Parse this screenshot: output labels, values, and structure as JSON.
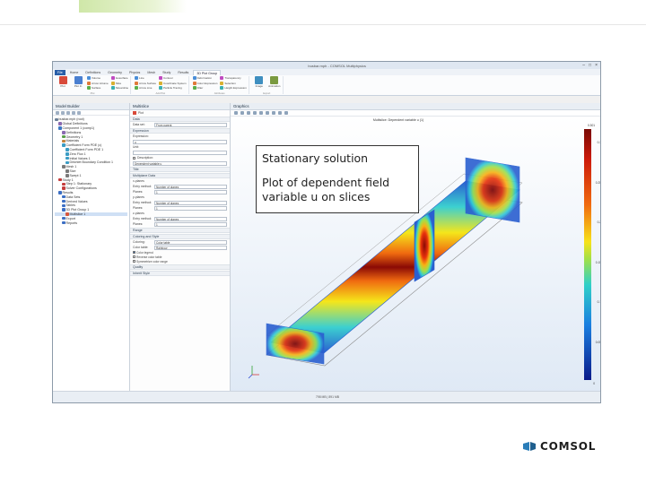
{
  "window": {
    "title": "busbar.mph - COMSOL Multiphysics"
  },
  "ribbon_tabs": [
    "File",
    "Home",
    "Definitions",
    "Geometry",
    "Physics",
    "Mesh",
    "Study",
    "Results",
    "3D Plot Group"
  ],
  "ribbon_groups": [
    {
      "name": "Plot",
      "big": [
        {
          "label": "Plot",
          "color": "#d84a3a"
        },
        {
          "label": "Plot In",
          "color": "#4a7fd0"
        }
      ],
      "small": [
        "Volume",
        "Arrow Volume",
        "Surface",
        "Isosurface",
        "Slice",
        "Streamline"
      ]
    },
    {
      "name": "Add Plot",
      "small": [
        "Line",
        "Arrow Surface",
        "Arrow Line",
        "Contour",
        "Coordinate System",
        "Particle Tracing"
      ]
    },
    {
      "name": "Attributes",
      "small": [
        "Deformation",
        "Color Expression",
        "Filter",
        "Transparency",
        "Selection",
        "Height Expression"
      ]
    },
    {
      "name": "Export",
      "big": [
        {
          "label": "Image",
          "color": "#3f8fc0"
        },
        {
          "label": "Animation",
          "color": "#7a9a40"
        }
      ]
    }
  ],
  "model_builder": {
    "title": "Model Builder",
    "tree": [
      {
        "label": "busbar.mph (root)",
        "indent": 0,
        "color": "#6a7f96"
      },
      {
        "label": "Global Definitions",
        "indent": 1,
        "color": "#8a6ab0"
      },
      {
        "label": "Component 1 (comp1)",
        "indent": 1,
        "color": "#3b78c4"
      },
      {
        "label": "Definitions",
        "indent": 2,
        "color": "#8a6ab0"
      },
      {
        "label": "Geometry 1",
        "indent": 2,
        "color": "#5aa04a"
      },
      {
        "label": "Materials",
        "indent": 2,
        "color": "#c4823b"
      },
      {
        "label": "Coefficient Form PDE (c)",
        "indent": 2,
        "color": "#3b9cc4"
      },
      {
        "label": "Coefficient Form PDE 1",
        "indent": 3,
        "color": "#3b9cc4"
      },
      {
        "label": "Zero Flux 1",
        "indent": 3,
        "color": "#3b9cc4"
      },
      {
        "label": "Initial Values 1",
        "indent": 3,
        "color": "#3b9cc4"
      },
      {
        "label": "Dirichlet Boundary Condition 1",
        "indent": 3,
        "color": "#3b9cc4"
      },
      {
        "label": "Mesh 1",
        "indent": 2,
        "color": "#7a7a7a"
      },
      {
        "label": "Size",
        "indent": 3,
        "color": "#7a7a7a"
      },
      {
        "label": "Swept 1",
        "indent": 3,
        "color": "#7a7a7a"
      },
      {
        "label": "Study 1",
        "indent": 1,
        "color": "#c43b3b"
      },
      {
        "label": "Step 1: Stationary",
        "indent": 2,
        "color": "#c43b3b"
      },
      {
        "label": "Solver Configurations",
        "indent": 2,
        "color": "#c43b3b"
      },
      {
        "label": "Results",
        "indent": 1,
        "color": "#3b6ec4"
      },
      {
        "label": "Data Sets",
        "indent": 2,
        "color": "#3b6ec4"
      },
      {
        "label": "Derived Values",
        "indent": 2,
        "color": "#3b6ec4"
      },
      {
        "label": "Tables",
        "indent": 2,
        "color": "#3b6ec4"
      },
      {
        "label": "3D Plot Group 1",
        "indent": 2,
        "color": "#3b6ec4"
      },
      {
        "label": "Multislice 1",
        "indent": 3,
        "color": "#d8553b",
        "selected": true
      },
      {
        "label": "Export",
        "indent": 2,
        "color": "#3b6ec4"
      },
      {
        "label": "Reports",
        "indent": 2,
        "color": "#3b6ec4"
      }
    ]
  },
  "settings": {
    "title": "Multislice",
    "plot_button": "Plot",
    "sections": {
      "data": "Data",
      "expression": "Expression",
      "title": "Title",
      "multiplane": "Multiplane Data",
      "range": "Range",
      "coloring": "Coloring and Style",
      "quality": "Quality",
      "inherit": "Inherit Style"
    },
    "data_set_label": "Data set:",
    "data_set_value": "From parent",
    "expression_label": "Expression:",
    "expression_value": "u",
    "unit_label": "Unit:",
    "description_label": "Description:",
    "description_value": "Dependent variable u",
    "x_planes_label": "x-planes",
    "y_planes_label": "y-planes",
    "z_planes_label": "z-planes",
    "entry_method_label": "Entry method:",
    "entry_method_value": "Number of planes",
    "planes_label": "Planes:",
    "planes_value": "1",
    "coloring_label": "Coloring:",
    "coloring_value": "Color table",
    "color_table_label": "Color table:",
    "color_table_value": "Rainbow",
    "checkboxes": [
      "Color legend",
      "Reverse color table",
      "Symmetrize color range"
    ]
  },
  "graphics": {
    "title": "Graphics",
    "plot_caption": "Multislice: Dependent variable u (1)",
    "colorbar_ticks": [
      "0.3",
      "0.25",
      "0.2",
      "0.15",
      "0.1",
      "0.05"
    ],
    "colorbar_max": "0.301",
    "colorbar_min": "0"
  },
  "statusbar": {
    "text": "798 MB | 891 MB"
  },
  "callout": {
    "line1": "Stationary solution",
    "line2": "Plot of dependent field variable u on slices"
  },
  "logo": {
    "text": "COMSOL",
    "color": "#2a7db8"
  }
}
